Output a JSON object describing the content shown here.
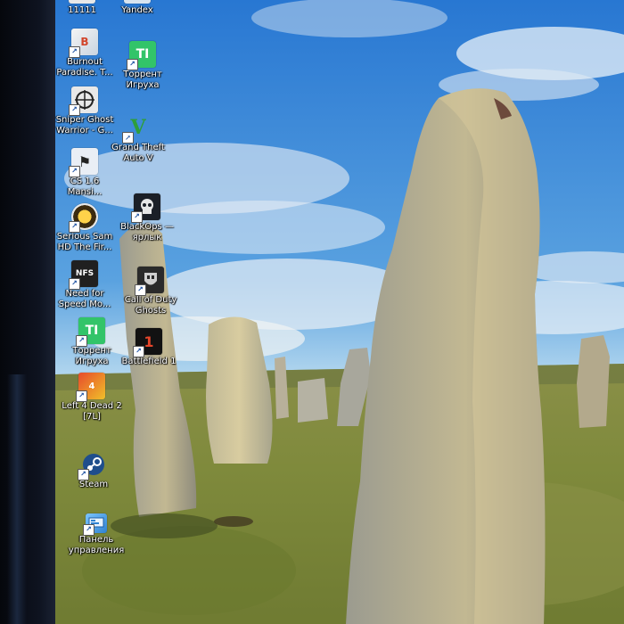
{
  "desktop_icons": [
    {
      "label": "11111",
      "icon": "shortcut-icon"
    },
    {
      "label": "Yandex",
      "icon": "yandex-browser-icon"
    },
    {
      "label": "Burnout\nParadise. T...",
      "icon": "burnout-paradise-icon"
    },
    {
      "label": "Торрент\nИгруха",
      "icon": "torrent-igruha-icon",
      "glyph": "TI"
    },
    {
      "label": "Sniper Ghost\nWarrior - G...",
      "icon": "sniper-ghost-warrior-icon"
    },
    {
      "label": "Grand Theft\nAuto V",
      "icon": "gta-v-icon",
      "glyph": "V"
    },
    {
      "label": "CS 1.6\nMansi...",
      "icon": "counter-strike-icon"
    },
    {
      "label": "Serious Sam\nHD The Fir...",
      "icon": "serious-sam-icon"
    },
    {
      "label": "BlackOps —\nярлык",
      "icon": "black-ops-icon"
    },
    {
      "label": "Need for\nSpeed Mo...",
      "icon": "need-for-speed-icon"
    },
    {
      "label": "Call of Duty\nGhosts",
      "icon": "call-of-duty-ghosts-icon"
    },
    {
      "label": "Торрент\nИгруха",
      "icon": "torrent-igruha-icon",
      "glyph": "TI"
    },
    {
      "label": "Battlefield 1",
      "icon": "battlefield-1-icon"
    },
    {
      "label": "Left 4 Dead 2\n[7L]",
      "icon": "left-4-dead-2-icon"
    },
    {
      "label": "Steam",
      "icon": "steam-icon"
    },
    {
      "label": "Панель\nуправления",
      "icon": "control-panel-icon"
    }
  ],
  "colors": {
    "sky_top": "#2f7fd6",
    "sky_bottom": "#bfe0f4",
    "grass": "#7d8a3a",
    "stone": "#cbbd92",
    "bezel": "#0b0f18"
  }
}
